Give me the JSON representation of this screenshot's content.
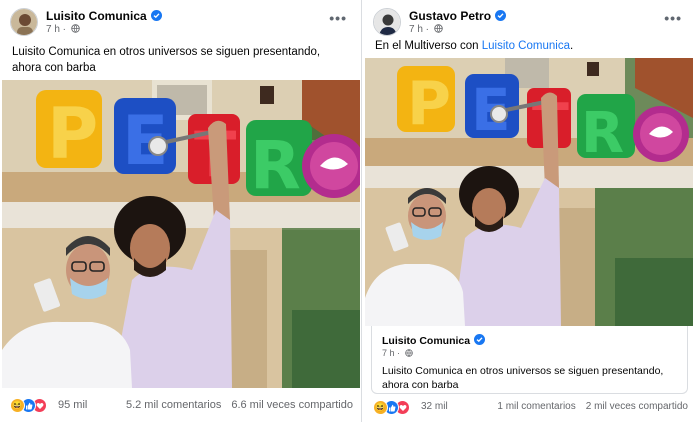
{
  "left_post": {
    "author": "Luisito Comunica",
    "time": "7 h ·",
    "text": "Luisito Comunica en otros universos se siguen presentando, ahora con barba",
    "reaction_count": "95 mil",
    "comments": "5.2 mil comentarios",
    "shares": "6.6 mil veces compartido",
    "photo_sign": "PETRO"
  },
  "right_post": {
    "author": "Gustavo Petro",
    "time": "7 h ·",
    "text_prefix": "En el Multiverso con ",
    "mention": "Luisito Comunica",
    "text_suffix": ".",
    "photo_sign": "PETRO",
    "shared": {
      "author": "Luisito Comunica",
      "time": "7 h ·",
      "text": "Luisito Comunica en otros universos se siguen presentando, ahora con barba"
    },
    "reaction_count": "32 mil",
    "comments": "1 mil comentarios",
    "shares": "2 mil veces compartido"
  },
  "icons": [
    "verified-badge-icon",
    "globe-icon",
    "more-options-icon",
    "haha-reaction-icon",
    "like-reaction-icon",
    "love-reaction-icon"
  ],
  "colors": {
    "facebook_blue": "#1877f2",
    "meta_gray": "#65676b",
    "love_red": "#f33e58",
    "haha_yellow": "#f7b125"
  }
}
